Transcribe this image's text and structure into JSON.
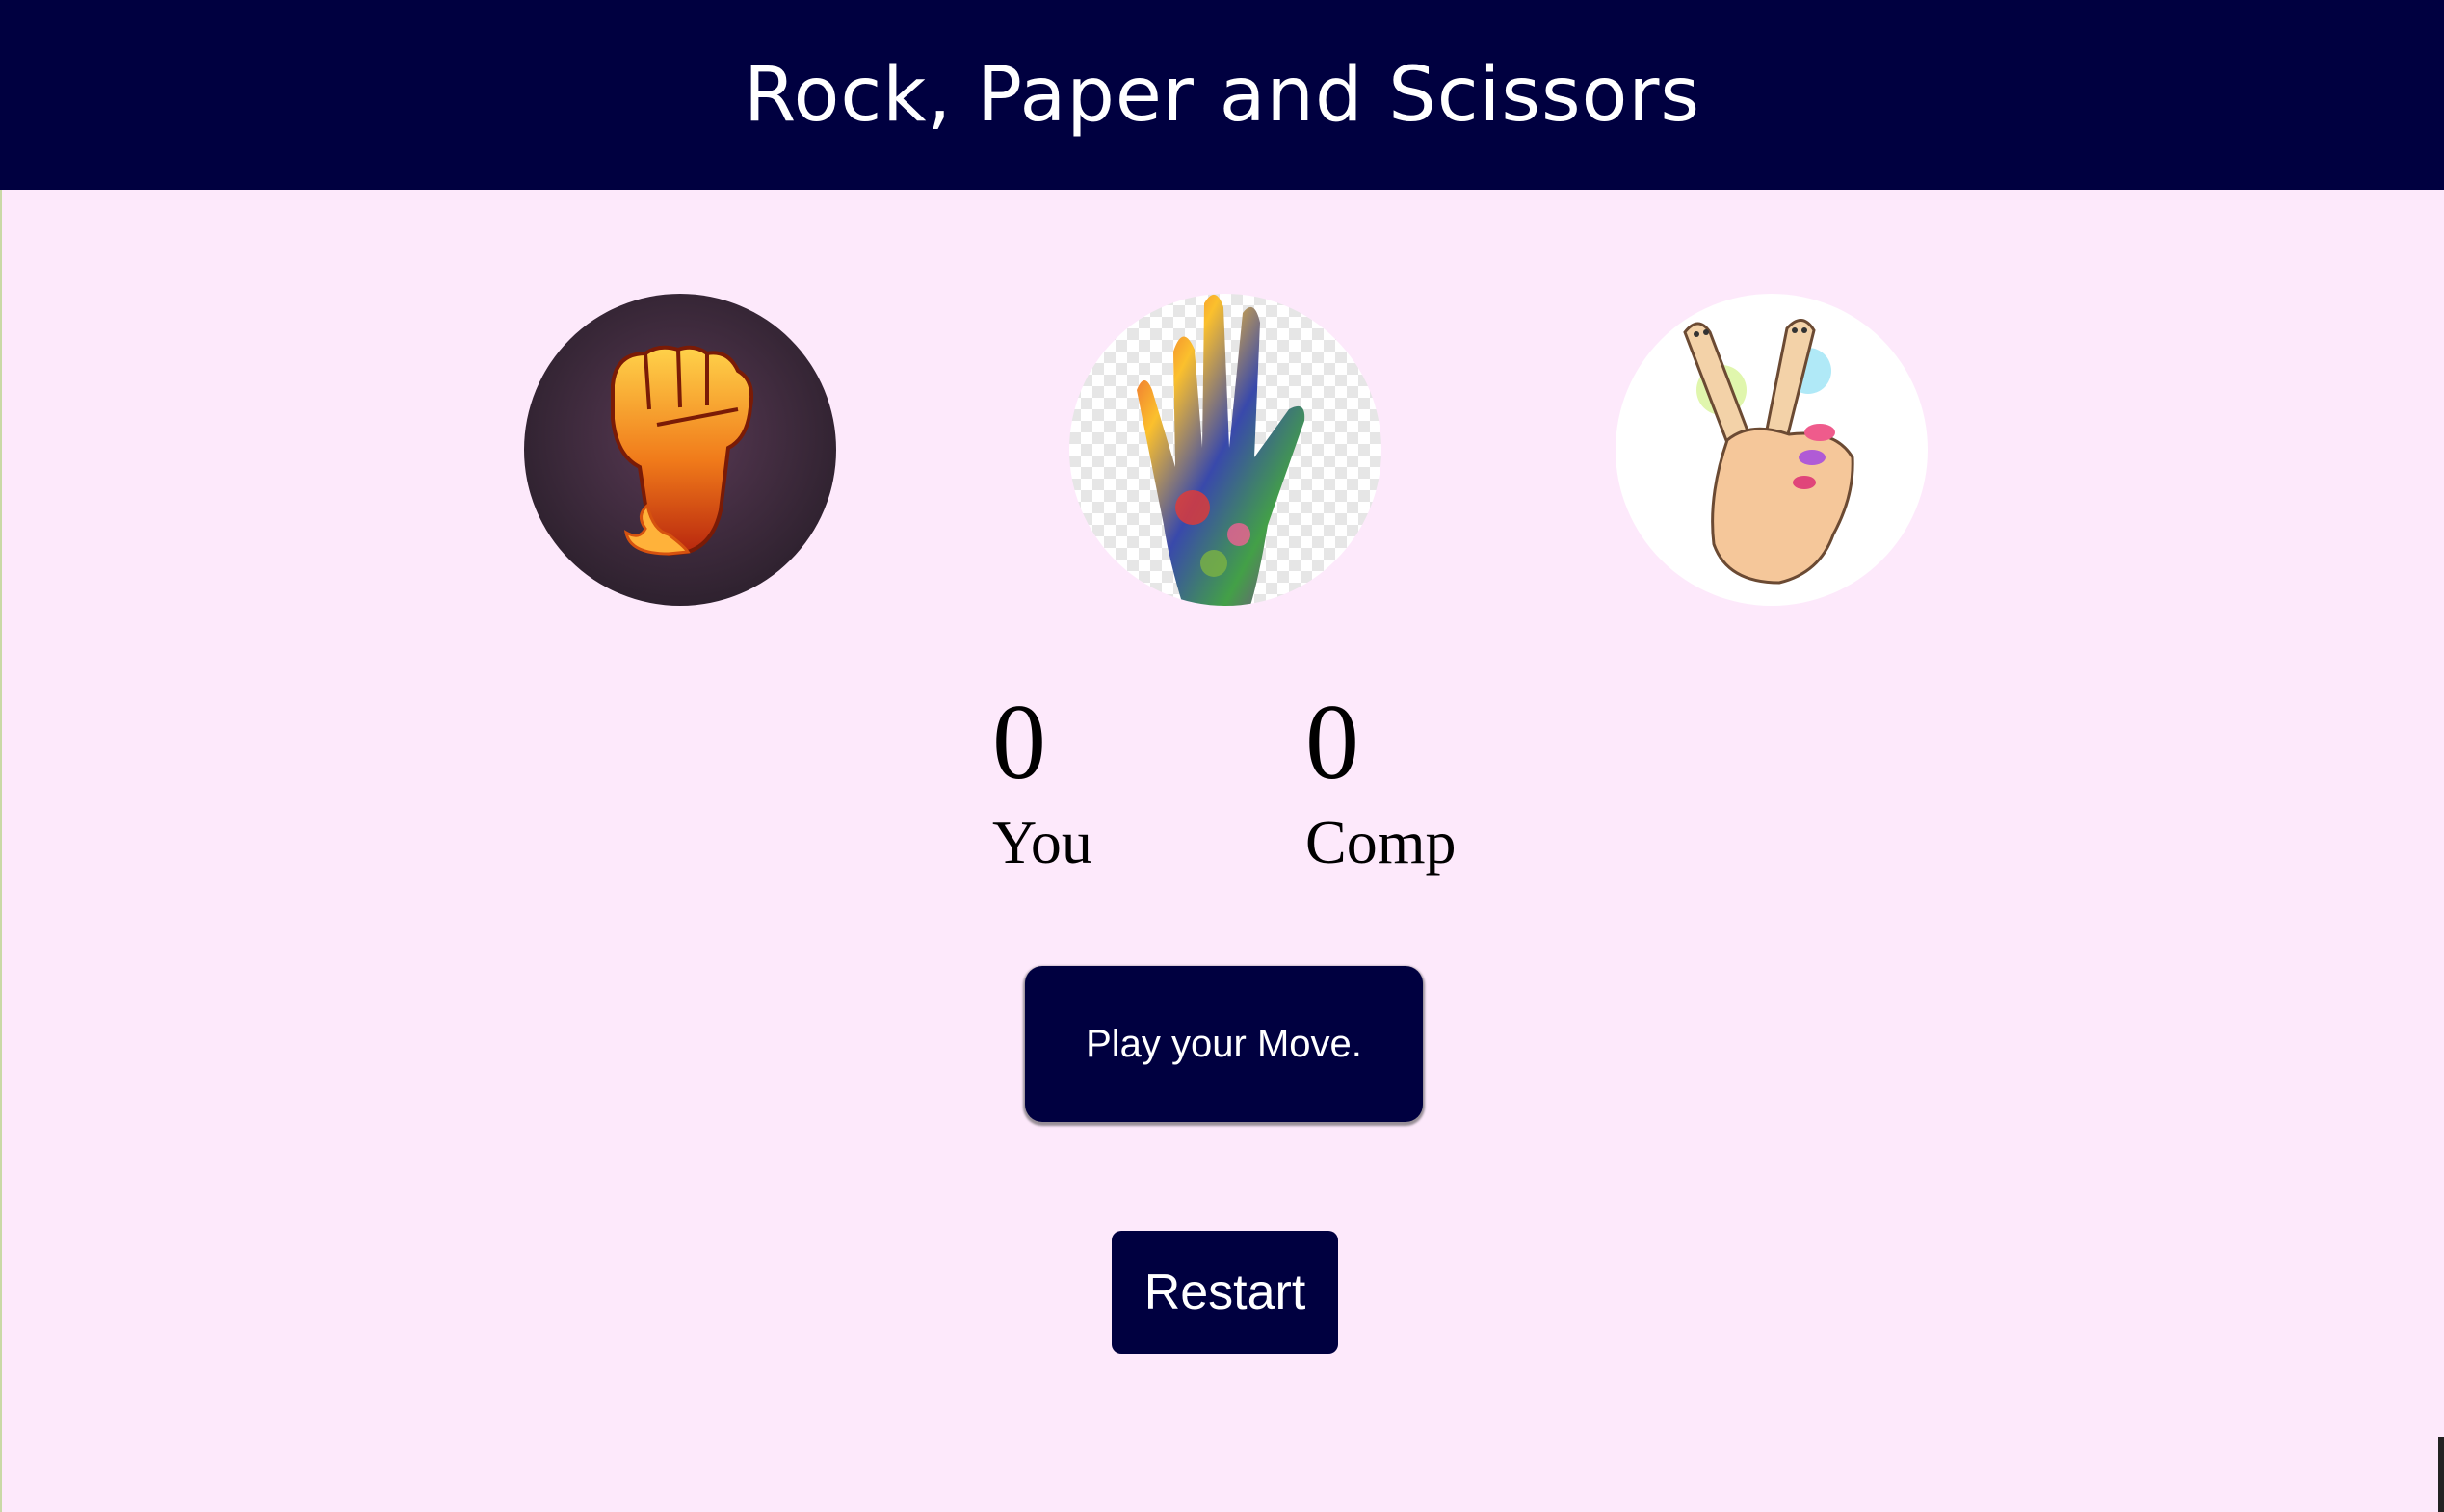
{
  "header": {
    "title": "Rock, Paper and Scissors"
  },
  "choices": [
    {
      "id": "rock",
      "icon": "fist-icon"
    },
    {
      "id": "paper",
      "icon": "open-hand-icon"
    },
    {
      "id": "scissors",
      "icon": "peace-sign-hand-icon"
    }
  ],
  "scoreboard": {
    "user": {
      "score": "0",
      "label": "You"
    },
    "comp": {
      "score": "0",
      "label": "Comp"
    }
  },
  "message": {
    "text": "Play your Move."
  },
  "controls": {
    "restart_label": "Restart"
  },
  "colors": {
    "header_bg": "#000040",
    "page_bg": "#fde9fb",
    "button_bg": "#000040",
    "button_text": "#ffffff"
  }
}
